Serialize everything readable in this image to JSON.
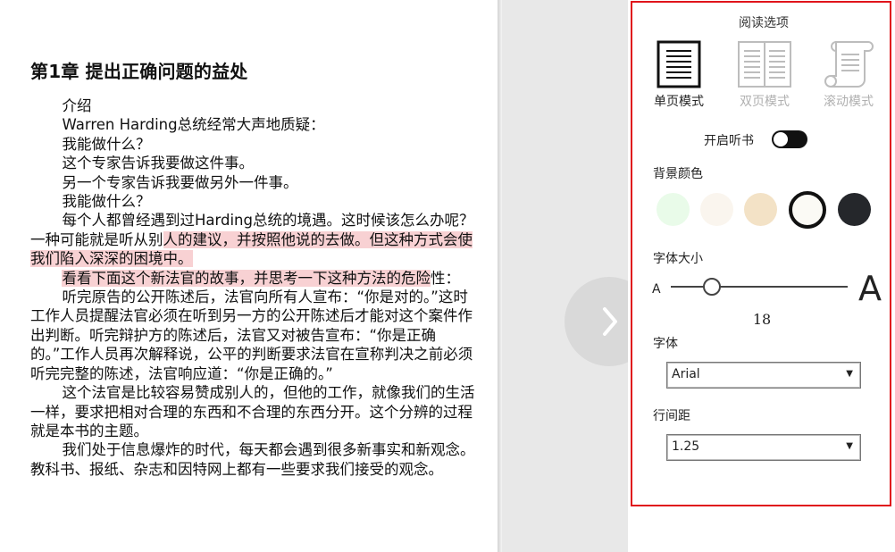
{
  "book": {
    "chapter_title": "第1章 提出正确问题的益处",
    "paragraphs": [
      {
        "segments": [
          {
            "text": "介绍",
            "highlight": false
          }
        ]
      },
      {
        "segments": [
          {
            "text": "Warren Harding总统经常大声地质疑：",
            "highlight": false
          }
        ]
      },
      {
        "segments": [
          {
            "text": "我能做什么？",
            "highlight": false
          }
        ]
      },
      {
        "segments": [
          {
            "text": "这个专家告诉我要做这件事。",
            "highlight": false
          }
        ]
      },
      {
        "segments": [
          {
            "text": "另一个专家告诉我要做另外一件事。",
            "highlight": false
          }
        ]
      },
      {
        "segments": [
          {
            "text": "我能做什么？",
            "highlight": false
          }
        ]
      },
      {
        "segments": [
          {
            "text": "每个人都曾经遇到过Harding总统的境遇。这时候该怎么办呢？一种可能就是听从别",
            "highlight": false
          },
          {
            "text": "人的建议，并按照他说的去做。但这种方式会使我们陷入深深的困境中。",
            "highlight": true
          }
        ]
      },
      {
        "segments": [
          {
            "text": "看看下面这个新法官的故事，并思考一下这种方法的危险",
            "highlight": true
          },
          {
            "text": "性：",
            "highlight": false
          }
        ]
      },
      {
        "segments": [
          {
            "text": "听完原告的公开陈述后，法官向所有人宣布：“你是对的。”这时工作人员提醒法官必须在听到另一方的公开陈述后才能对这个案件作出判断。听完辩护方的陈述后，法官又对被告宣布：“你是正确的。”工作人员再次解释说，公平的判断要求法官在宣称判决之前必须听完完整的陈述，法官响应道：“你是正确的。”",
            "highlight": false
          }
        ]
      },
      {
        "segments": [
          {
            "text": "这个法官是比较容易赞成别人的，但他的工作，就像我们的生活一样，要求把相对合理的东西和不合理的东西分开。这个分辨的过程就是本书的主题。",
            "highlight": false
          }
        ]
      },
      {
        "segments": [
          {
            "text": "我们处于信息爆炸的时代，每天都会遇到很多新事实和新观念。教科书、报纸、杂志和因特网上都有一些要求我们接受的观念。",
            "highlight": false
          }
        ]
      }
    ],
    "highlight_color": "#f8d1d3"
  },
  "next_page": {
    "icon": "chevron-right-icon"
  },
  "options": {
    "title": "阅读选项",
    "modes": [
      {
        "label": "单页模式",
        "icon": "single-page-icon",
        "selected": true
      },
      {
        "label": "双页模式",
        "icon": "double-page-icon",
        "selected": false
      },
      {
        "label": "滚动模式",
        "icon": "scroll-icon",
        "selected": false
      }
    ],
    "tts": {
      "label": "开启听书",
      "on": false
    },
    "background": {
      "label": "背景颜色",
      "swatches": [
        "#e9fbe9",
        "#faf5ee",
        "#f3e2c6",
        "#fbfaf5",
        "#25272b"
      ],
      "selected_index": 3
    },
    "font_size": {
      "label": "字体大小",
      "small_glyph": "A",
      "large_glyph": "A",
      "value": "18",
      "fraction": 0.23
    },
    "font": {
      "label": "字体",
      "value": "Arial"
    },
    "line_spacing": {
      "label": "行间距",
      "value": "1.25"
    },
    "border_color": "#e0141c"
  }
}
